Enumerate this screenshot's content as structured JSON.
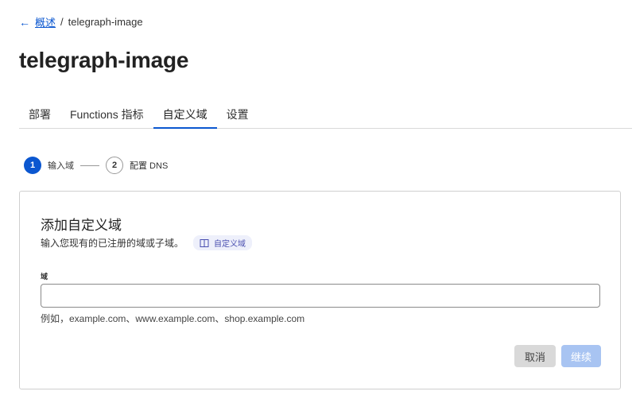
{
  "breadcrumb": {
    "back_link": "概述",
    "separator": "/",
    "current": "telegraph-image"
  },
  "page_title": "telegraph-image",
  "tabs": [
    {
      "label": "部署",
      "active": false
    },
    {
      "label": "Functions 指标",
      "active": false
    },
    {
      "label": "自定义域",
      "active": true
    },
    {
      "label": "设置",
      "active": false
    }
  ],
  "stepper": {
    "steps": [
      {
        "number": "1",
        "label": "输入域",
        "active": true
      },
      {
        "number": "2",
        "label": "配置 DNS",
        "active": false
      }
    ]
  },
  "card": {
    "title": "添加自定义域",
    "description": "输入您现有的已注册的域或子域。",
    "doc_badge": "自定义域",
    "field_label": "域",
    "input_value": "",
    "input_placeholder": "",
    "hint": "例如，example.com、www.example.com、shop.example.com",
    "cancel_label": "取消",
    "continue_label": "继续"
  },
  "colors": {
    "accent": "#0b57d0",
    "continue_disabled": "#a8c4f2",
    "cancel_bg": "#d9d9d9"
  },
  "icons": {
    "back": "arrow-left-icon",
    "doc": "book-icon"
  }
}
